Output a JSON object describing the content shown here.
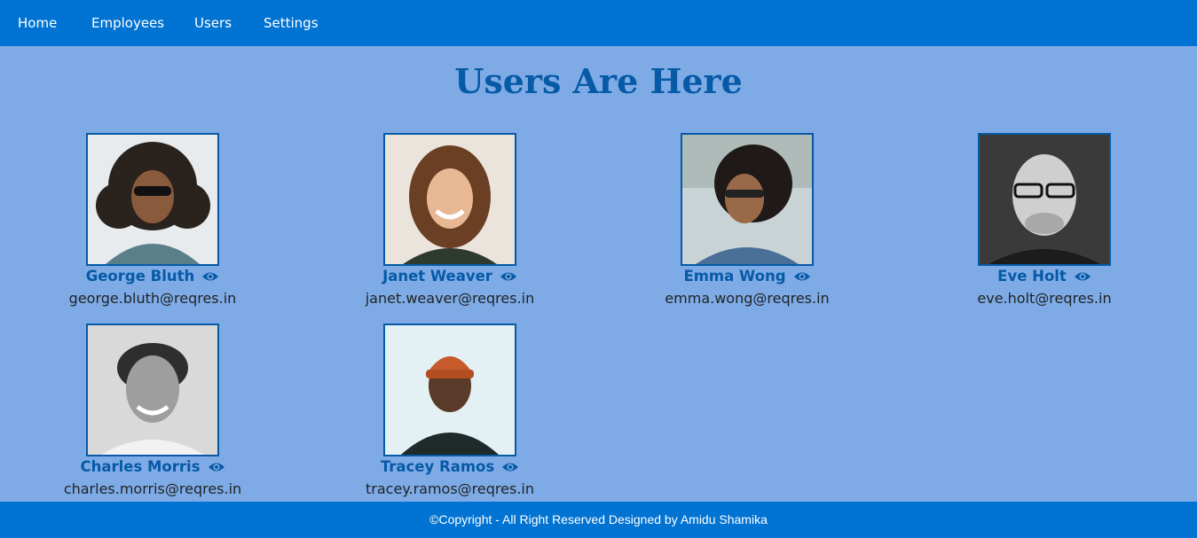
{
  "nav": {
    "items": [
      {
        "label": "Home"
      },
      {
        "label": "Employees"
      },
      {
        "label": "Users"
      },
      {
        "label": "Settings"
      }
    ]
  },
  "page": {
    "title": "Users Are Here"
  },
  "users": [
    {
      "name": "George Bluth",
      "email": "george.bluth@reqres.in"
    },
    {
      "name": "Janet Weaver",
      "email": "janet.weaver@reqres.in"
    },
    {
      "name": "Emma Wong",
      "email": "emma.wong@reqres.in"
    },
    {
      "name": "Eve Holt",
      "email": "eve.holt@reqres.in"
    },
    {
      "name": "Charles Morris",
      "email": "charles.morris@reqres.in"
    },
    {
      "name": "Tracey Ramos",
      "email": "tracey.ramos@reqres.in"
    }
  ],
  "footer": {
    "text": "©Copyright - All Right Reserved Designed by Amidu Shamika"
  },
  "colors": {
    "nav_bg": "#0173d2",
    "page_bg": "#7eabe6",
    "accent": "#065aa6"
  }
}
